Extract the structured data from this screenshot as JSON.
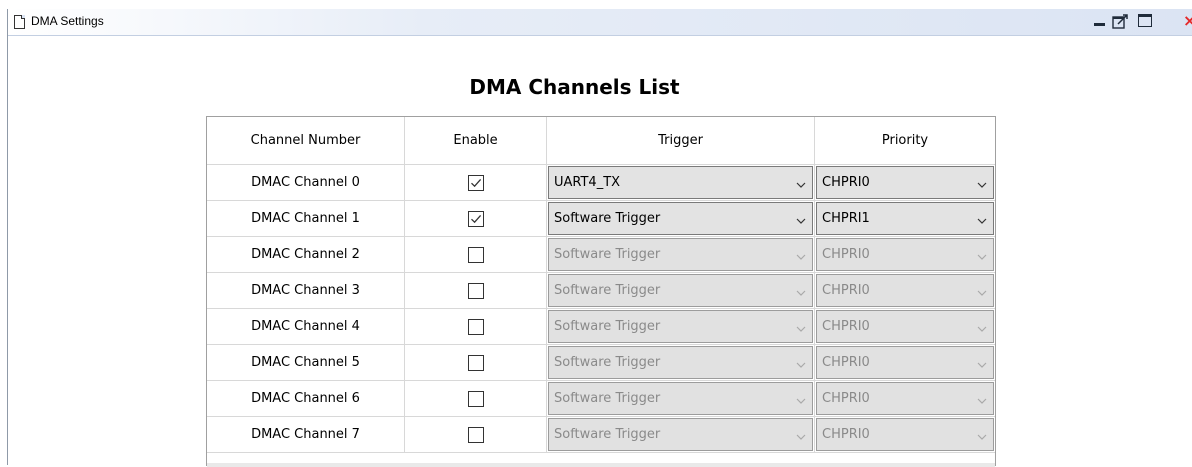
{
  "window": {
    "title": "DMA Settings"
  },
  "heading": "DMA Channels List",
  "table": {
    "headers": [
      "Channel Number",
      "Enable",
      "Trigger",
      "Priority"
    ],
    "rows": [
      {
        "channel": "DMAC Channel 0",
        "enabled": true,
        "trigger": "UART4_TX",
        "priority": "CHPRI0"
      },
      {
        "channel": "DMAC Channel 1",
        "enabled": true,
        "trigger": "Software Trigger",
        "priority": "CHPRI1"
      },
      {
        "channel": "DMAC Channel 2",
        "enabled": false,
        "trigger": "Software Trigger",
        "priority": "CHPRI0"
      },
      {
        "channel": "DMAC Channel 3",
        "enabled": false,
        "trigger": "Software Trigger",
        "priority": "CHPRI0"
      },
      {
        "channel": "DMAC Channel 4",
        "enabled": false,
        "trigger": "Software Trigger",
        "priority": "CHPRI0"
      },
      {
        "channel": "DMAC Channel 5",
        "enabled": false,
        "trigger": "Software Trigger",
        "priority": "CHPRI0"
      },
      {
        "channel": "DMAC Channel 6",
        "enabled": false,
        "trigger": "Software Trigger",
        "priority": "CHPRI0"
      },
      {
        "channel": "DMAC Channel 7",
        "enabled": false,
        "trigger": "Software Trigger",
        "priority": "CHPRI0"
      }
    ]
  },
  "icons": {
    "title": "document-icon",
    "minimize": "minimize-icon",
    "detach": "detach-icon",
    "maximize": "maximize-icon",
    "close": "close-icon",
    "checkbox": "checkmark-icon",
    "dropdown": "chevron-down-icon"
  },
  "colors": {
    "title_gradient_end": "#dbe4f3",
    "close": "#e52a2a",
    "disabled_text": "#8a8a8a",
    "combo_bg": "#e1e1e1"
  }
}
